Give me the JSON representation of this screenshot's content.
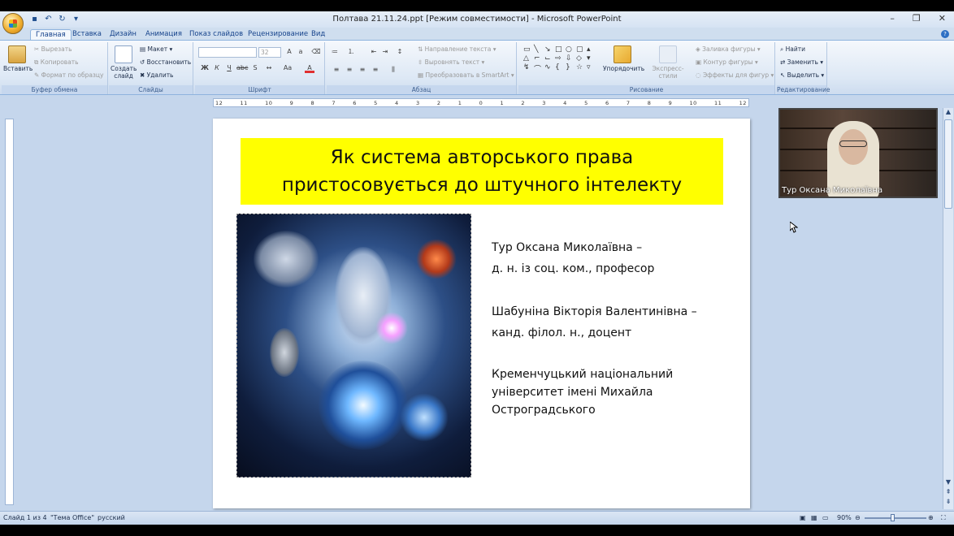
{
  "window": {
    "title": "Полтава 21.11.24.ppt [Режим совместимости] - Microsoft PowerPoint"
  },
  "ribbon_tabs": [
    "Главная",
    "Вставка",
    "Дизайн",
    "Анимация",
    "Показ слайдов",
    "Рецензирование",
    "Вид"
  ],
  "ribbon": {
    "clipboard": {
      "label": "Буфер обмена",
      "paste": "Вставить",
      "cut": "Вырезать",
      "copy": "Копировать",
      "format_painter": "Формат по образцу"
    },
    "slides": {
      "label": "Слайды",
      "new_slide": "Создать слайд",
      "layout": "Макет",
      "reset": "Восстановить",
      "delete": "Удалить"
    },
    "font": {
      "label": "Шрифт",
      "size": "32"
    },
    "paragraph": {
      "label": "Абзац",
      "text_direction": "Направление текста",
      "align_text": "Выровнять текст",
      "smartart": "Преобразовать в SmartArt"
    },
    "drawing": {
      "label": "Рисование",
      "arrange": "Упорядочить",
      "quick_styles": "Экспресс-стили",
      "shape_fill": "Заливка фигуры",
      "shape_outline": "Контур фигуры",
      "shape_effects": "Эффекты для фигур"
    },
    "editing": {
      "label": "Редактирование",
      "find": "Найти",
      "replace": "Заменить",
      "select": "Выделить"
    }
  },
  "ruler": {
    "marks": [
      "12",
      "11",
      "10",
      "9",
      "8",
      "7",
      "6",
      "5",
      "4",
      "3",
      "2",
      "1",
      "0",
      "1",
      "2",
      "3",
      "4",
      "5",
      "6",
      "7",
      "8",
      "9",
      "10",
      "11",
      "12"
    ]
  },
  "slide": {
    "title_line1": "Як система авторського права",
    "title_line2": "пристосовується  до штучного інтелекту",
    "author1_name": "Тур Оксана Миколаївна –",
    "author1_title": "д. н. із соц. ком., професор",
    "author2_name": "Шабуніна Вікторія Валентинівна –",
    "author2_title": "канд. філол. н., доцент",
    "uni_line1": "Кременчуцький національний",
    "uni_line2": "університет імені Михайла",
    "uni_line3": "Остроградського"
  },
  "webcam": {
    "participant_name": "Тур Оксана Миколаївна"
  },
  "status": {
    "slide_counter": "Слайд 1 из 4",
    "theme": "\"Тема Office\"",
    "language": "русский",
    "zoom": "90%"
  }
}
